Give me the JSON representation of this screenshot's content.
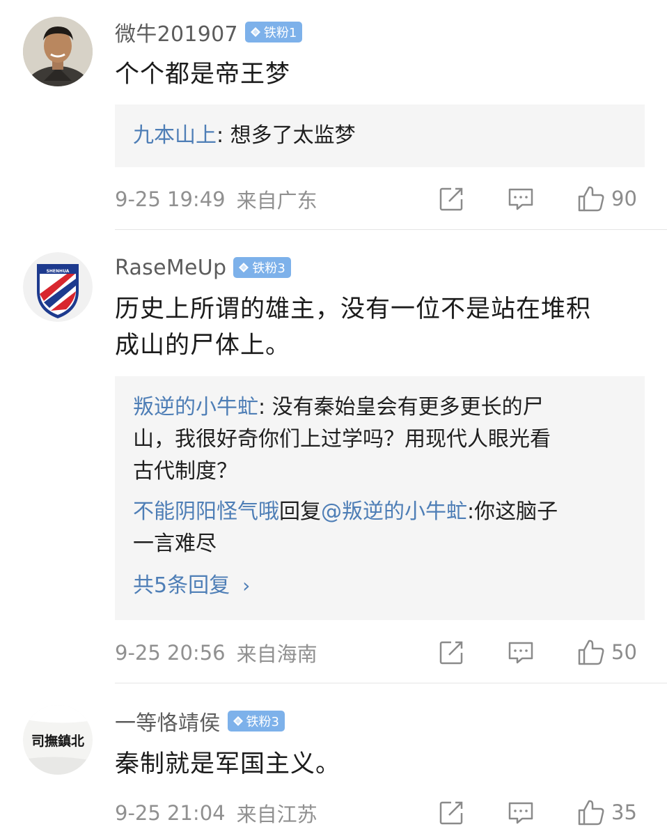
{
  "comments": [
    {
      "username": "微牛201907",
      "badge": "铁粉1",
      "text": "个个都是帝王梦",
      "replies": [
        {
          "name": "九本山上",
          "sep": ": ",
          "text": "想多了太监梦"
        }
      ],
      "time": "9-25 19:49",
      "location": "来自广东",
      "likes": "90"
    },
    {
      "username": "RaseMeUp",
      "badge": "铁粉3",
      "text_line1": "历史上所谓的雄主，没有一位不是站在堆积",
      "text_line2": "成山的尸体上。",
      "avatar_text": "SHENHUA",
      "replies": [
        {
          "name": "叛逆的小牛虻",
          "sep": ": ",
          "line1": "没有秦始皇会有更多更长的尸",
          "line2": "山，我很好奇你们上过学吗？用现代人眼光看",
          "line3": "古代制度？"
        },
        {
          "name": "不能阴阳怪气哦",
          "reply_word": "回复",
          "target": "@叛逆的小牛虻",
          "line1": ":你这脑子",
          "line2": "一言难尽"
        }
      ],
      "more_replies": "共5条回复",
      "more_chevron": "›",
      "time": "9-25 20:56",
      "location": "来自海南",
      "likes": "50"
    },
    {
      "username": "一等恪靖侯",
      "badge": "铁粉3",
      "text": "秦制就是军国主义。",
      "avatar_text": "司撫鎮北",
      "time": "9-25 21:04",
      "location": "来自江苏",
      "likes": "35"
    }
  ],
  "icons": {
    "share": "share-icon",
    "comment": "comment-icon",
    "like": "thumbs-up-icon",
    "badge": "diamond-icon"
  },
  "colors": {
    "badge": "#7db1ea",
    "link": "#4e7eb6",
    "meta": "#909090",
    "reply_bg": "#f5f5f5"
  }
}
